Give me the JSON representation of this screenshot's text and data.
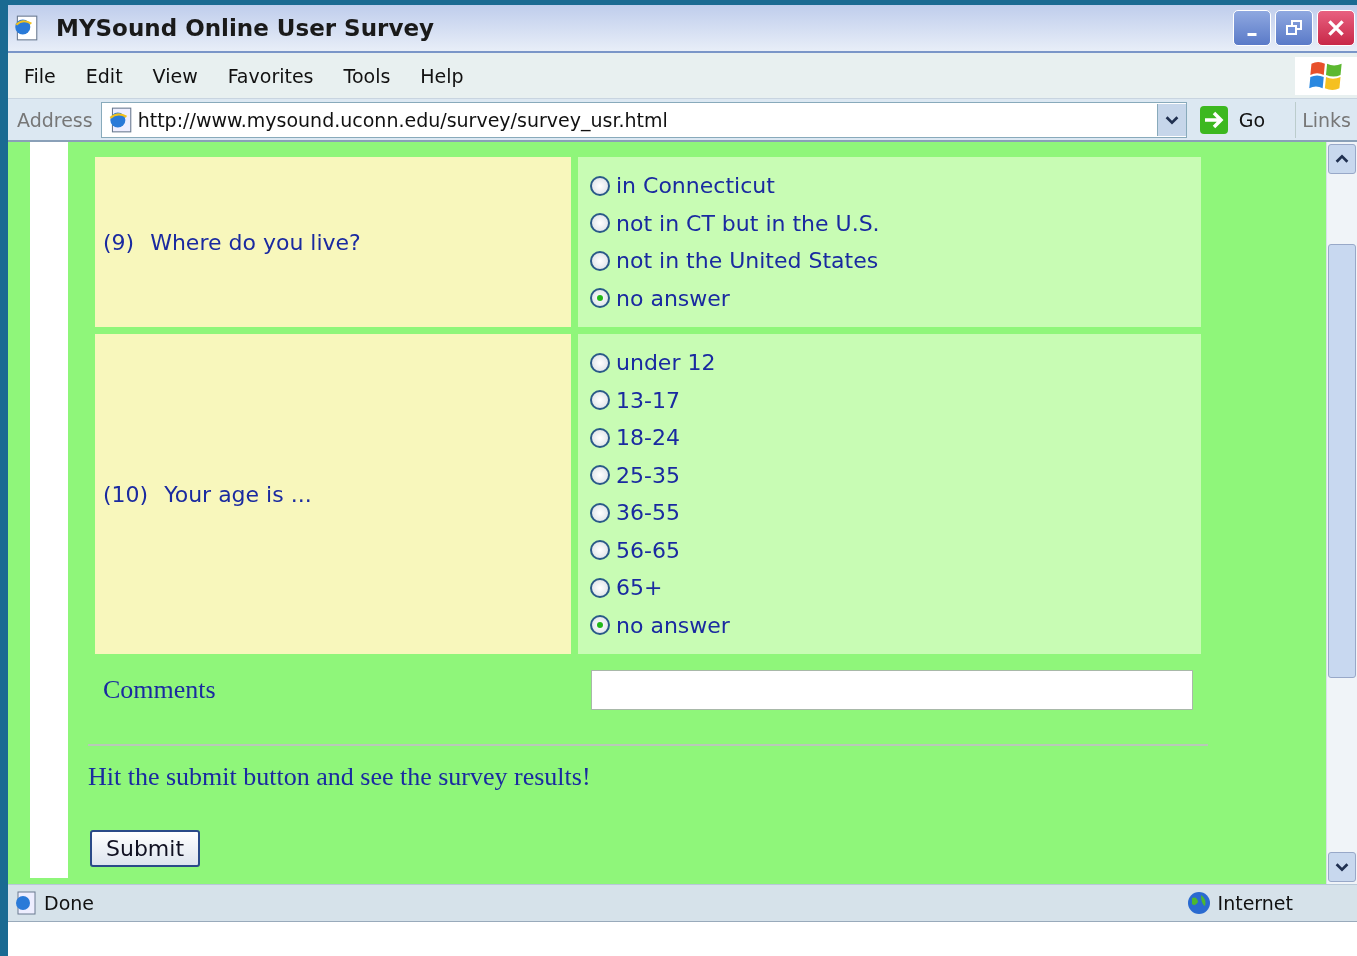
{
  "window": {
    "title": "MYSound Online User Survey"
  },
  "menu": [
    "File",
    "Edit",
    "View",
    "Favorites",
    "Tools",
    "Help"
  ],
  "address_bar": {
    "label": "Address",
    "url": "http://www.mysound.uconn.edu/survey/survey_usr.html",
    "go": "Go",
    "links": "Links"
  },
  "questions": [
    {
      "number": "(9)",
      "text": "Where do you live?",
      "options": [
        {
          "label": "in Connecticut",
          "selected": false
        },
        {
          "label": "not in CT but in the U.S.",
          "selected": false
        },
        {
          "label": "not in the United States",
          "selected": false
        },
        {
          "label": "no answer",
          "selected": true
        }
      ]
    },
    {
      "number": "(10)",
      "text": "Your age is ...",
      "options": [
        {
          "label": "under 12",
          "selected": false
        },
        {
          "label": "13-17",
          "selected": false
        },
        {
          "label": "18-24",
          "selected": false
        },
        {
          "label": "25-35",
          "selected": false
        },
        {
          "label": "36-55",
          "selected": false
        },
        {
          "label": "56-65",
          "selected": false
        },
        {
          "label": "65+",
          "selected": false
        },
        {
          "label": "no answer",
          "selected": true
        }
      ]
    }
  ],
  "comments": {
    "label": "Comments"
  },
  "submit_note": "Hit the submit button and see the survey results!",
  "submit_button": "Submit",
  "status_bar": {
    "text": "Done",
    "zone": "Internet"
  }
}
